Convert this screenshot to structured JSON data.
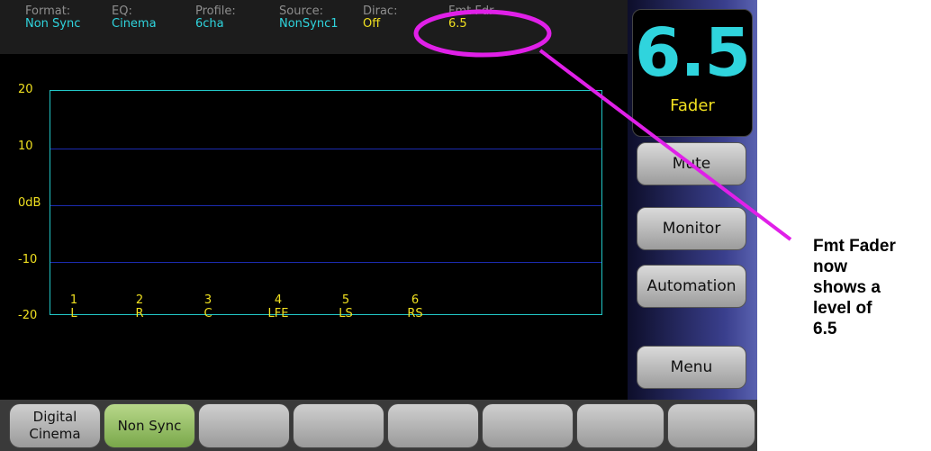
{
  "status_bar": [
    {
      "label": "Format:",
      "value": "Non Sync",
      "color": "#2fd4dd"
    },
    {
      "label": "EQ:",
      "value": "Cinema",
      "color": "#2fd4dd"
    },
    {
      "label": "Profile:",
      "value": "6cha",
      "color": "#2fd4dd"
    },
    {
      "label": "Source:",
      "value": "NonSync1",
      "color": "#2fd4dd"
    },
    {
      "label": "Dirac:",
      "value": "Off",
      "color": "#f0e020"
    },
    {
      "label": "Fmt Fdr",
      "value": "6.5",
      "color": "#f0e020"
    }
  ],
  "graph": {
    "y_labels": [
      "20",
      "10",
      "0dB",
      "-10",
      "-20"
    ],
    "channels": [
      {
        "num": "1",
        "name": "L"
      },
      {
        "num": "2",
        "name": "R"
      },
      {
        "num": "3",
        "name": "C"
      },
      {
        "num": "4",
        "name": "LFE"
      },
      {
        "num": "5",
        "name": "LS"
      },
      {
        "num": "6",
        "name": "RS"
      }
    ]
  },
  "fader": {
    "value": "6.5",
    "label": "Fader"
  },
  "side_buttons": {
    "mute": "Mute",
    "monitor": "Monitor",
    "automation": "Automation",
    "menu": "Menu"
  },
  "bottom_buttons": [
    {
      "label": "Digital\nCinema",
      "active": false
    },
    {
      "label": "Non Sync",
      "active": true
    },
    {
      "label": "",
      "active": false
    },
    {
      "label": "",
      "active": false
    },
    {
      "label": "",
      "active": false
    },
    {
      "label": "",
      "active": false
    },
    {
      "label": "",
      "active": false
    },
    {
      "label": "",
      "active": false
    }
  ],
  "callout": {
    "line1": "Fmt Fader",
    "line2": "now",
    "line3": "shows a",
    "line4": "level of",
    "line5": "6.5"
  },
  "colors": {
    "accent_cyan": "#2fd4dd",
    "accent_yellow": "#f0e020",
    "annotation_magenta": "#e020e8"
  }
}
